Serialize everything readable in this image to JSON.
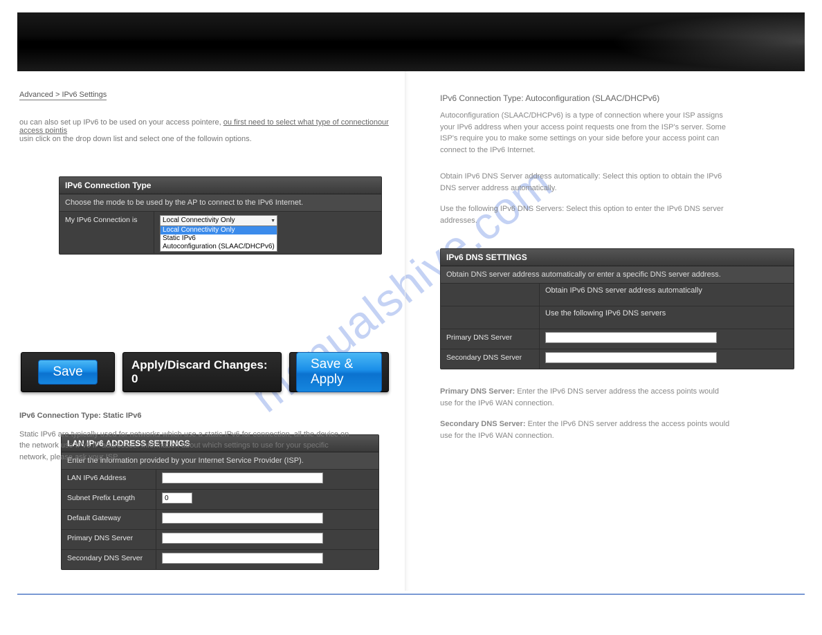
{
  "crumb": "Advanced > IPv6 Settings",
  "intro": {
    "line1_a": "ou can also set up IPv6 to be used on your access pointere, ",
    "line1_b": "ou first need to select what type of connectionour access pointis",
    "line2": "usin click on the drop down list and select one of the followin options."
  },
  "conn_panel": {
    "header": "IPv6 Connection Type",
    "sub": "Choose the mode to be used by the AP to connect to the IPv6 Internet.",
    "label": "My IPv6 Connection is",
    "selected": "Local Connectivity Only",
    "options": [
      "Local Connectivity Only",
      "Static IPv6",
      "Autoconfiguration (SLAAC/DHCPv6)"
    ]
  },
  "buttons": {
    "save": "Save",
    "counter": "Apply/Discard Changes: 0",
    "save_apply": "Save & Apply"
  },
  "conn_desc": {
    "head": "IPv6 Connection Type: Static IPv6",
    "body": "Static IPv6 are typically used for networks which use a static IPv6 for connection, all the device on the network use IPv6 IP addresses. Information about which settings to use for your specific network, please ask your ISP."
  },
  "lan_panel": {
    "header": "LAN IPv6 ADDRESS SETTINGS",
    "sub": "Enter the information provided by your Internet Service Provider (ISP).",
    "rows": {
      "addr": "LAN IPv6 Address",
      "prefix": "Subnet Prefix Length",
      "gw": "Default Gateway",
      "pdns": "Primary DNS Server",
      "sdns": "Secondary DNS Server"
    },
    "prefix_value": "0"
  },
  "right": {
    "heading": "IPv6 Connection Type: Autoconfiguration (SLAAC/DHCPv6)",
    "desc": "Autoconfiguration (SLAAC/DHCPv6) is a type of connection where your ISP assigns your IPv6 address when your access point requests one from the ISP's server. Some ISP's require you to make some settings on your side before your access point can connect to the IPv6 Internet.",
    "obtain_prefix": "Obtain IPv6 DNS Server address automatically: Select this option to obtain the IPv6 DNS server address automatically.",
    "use_following_prefix": "Use the following IPv6 DNS Servers: Select this option to enter the IPv6 DNS server addresses.",
    "pdns_label": "Primary DNS Server:",
    "pdns_body": "Enter the IPv6 DNS server address the access points would use for the IPv6 WAN connection.",
    "sdns_label": "Secondary DNS Server:",
    "sdns_body": "Enter the IPv6 DNS server address the access points would use for the IPv6 WAN connection."
  },
  "dns_panel": {
    "header": "IPv6 DNS SETTINGS",
    "sub": "Obtain DNS server address automatically or enter a specific DNS server address.",
    "opt1": "Obtain IPv6 DNS server address automatically",
    "opt2": "Use the following IPv6 DNS servers",
    "pdns": "Primary DNS Server",
    "sdns": "Secondary DNS Server"
  },
  "watermark": "manualshive.com"
}
